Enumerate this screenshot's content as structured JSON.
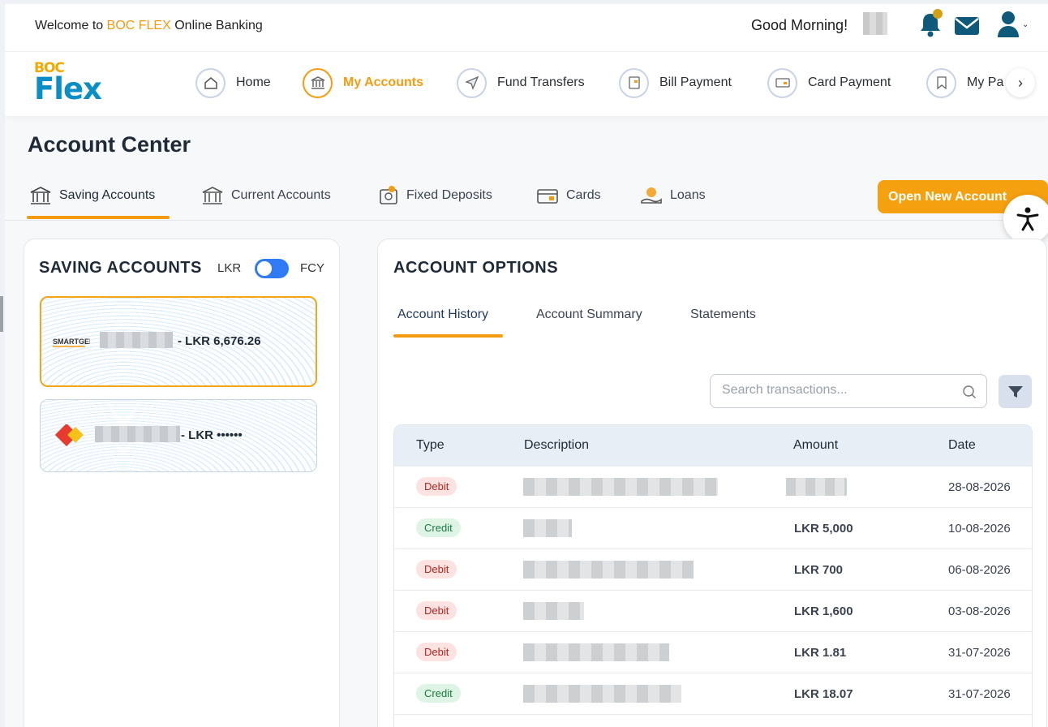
{
  "header": {
    "welcome_prefix": "Welcome to",
    "welcome_brand": "BOC FLEX",
    "welcome_suffix": "Online Banking",
    "greeting": "Good Morning!",
    "icons": [
      "bell-icon",
      "mail-icon",
      "user-icon"
    ],
    "notification_dot_color": "#d4a017"
  },
  "logo": {
    "top": "BOC",
    "bottom": "Flex"
  },
  "nav": {
    "items": [
      {
        "label": "Home",
        "icon": "home-icon"
      },
      {
        "label": "My Accounts",
        "icon": "bank-icon",
        "active": true
      },
      {
        "label": "Fund Transfers",
        "icon": "send-icon"
      },
      {
        "label": "Bill Payment",
        "icon": "bill-icon"
      },
      {
        "label": "Card Payment",
        "icon": "card-icon"
      },
      {
        "label": "My Pa",
        "icon": "bookmark-icon"
      }
    ],
    "next_icon": "›"
  },
  "page": {
    "title": "Account Center"
  },
  "account_tabs": [
    {
      "label": "Saving Accounts",
      "active": true
    },
    {
      "label": "Current Accounts"
    },
    {
      "label": "Fixed Deposits"
    },
    {
      "label": "Cards"
    },
    {
      "label": "Loans"
    }
  ],
  "open_new_account": "Open New Account",
  "saving": {
    "heading": "SAVING ACCOUNTS",
    "currency_left": "LKR",
    "currency_right": "FCY",
    "accounts": [
      {
        "suffix": "- LKR 6,676.26",
        "logo": "SMARTGEN",
        "selected": true
      },
      {
        "suffix": "- LKR ••••••",
        "logo": "18 Golden",
        "selected": false
      }
    ]
  },
  "options": {
    "heading": "ACCOUNT OPTIONS",
    "tabs": [
      "Account History",
      "Account Summary",
      "Statements"
    ],
    "search_placeholder": "Search transactions...",
    "table": {
      "headers": [
        "Type",
        "Description",
        "Amount",
        "Date"
      ],
      "rows": [
        {
          "type": "Debit",
          "amount": "",
          "date": "28-08-2026"
        },
        {
          "type": "Credit",
          "amount": "LKR 5,000",
          "date": "10-08-2026"
        },
        {
          "type": "Debit",
          "amount": "LKR 700",
          "date": "06-08-2026"
        },
        {
          "type": "Debit",
          "amount": "LKR 1,600",
          "date": "03-08-2026"
        },
        {
          "type": "Debit",
          "amount": "LKR 1.81",
          "date": "31-07-2026"
        },
        {
          "type": "Credit",
          "amount": "LKR 18.07",
          "date": "31-07-2026"
        }
      ]
    }
  },
  "colors": {
    "accent": "#f39c12",
    "brand_blue": "#0a8ec5",
    "toggle": "#2f7bf5"
  }
}
